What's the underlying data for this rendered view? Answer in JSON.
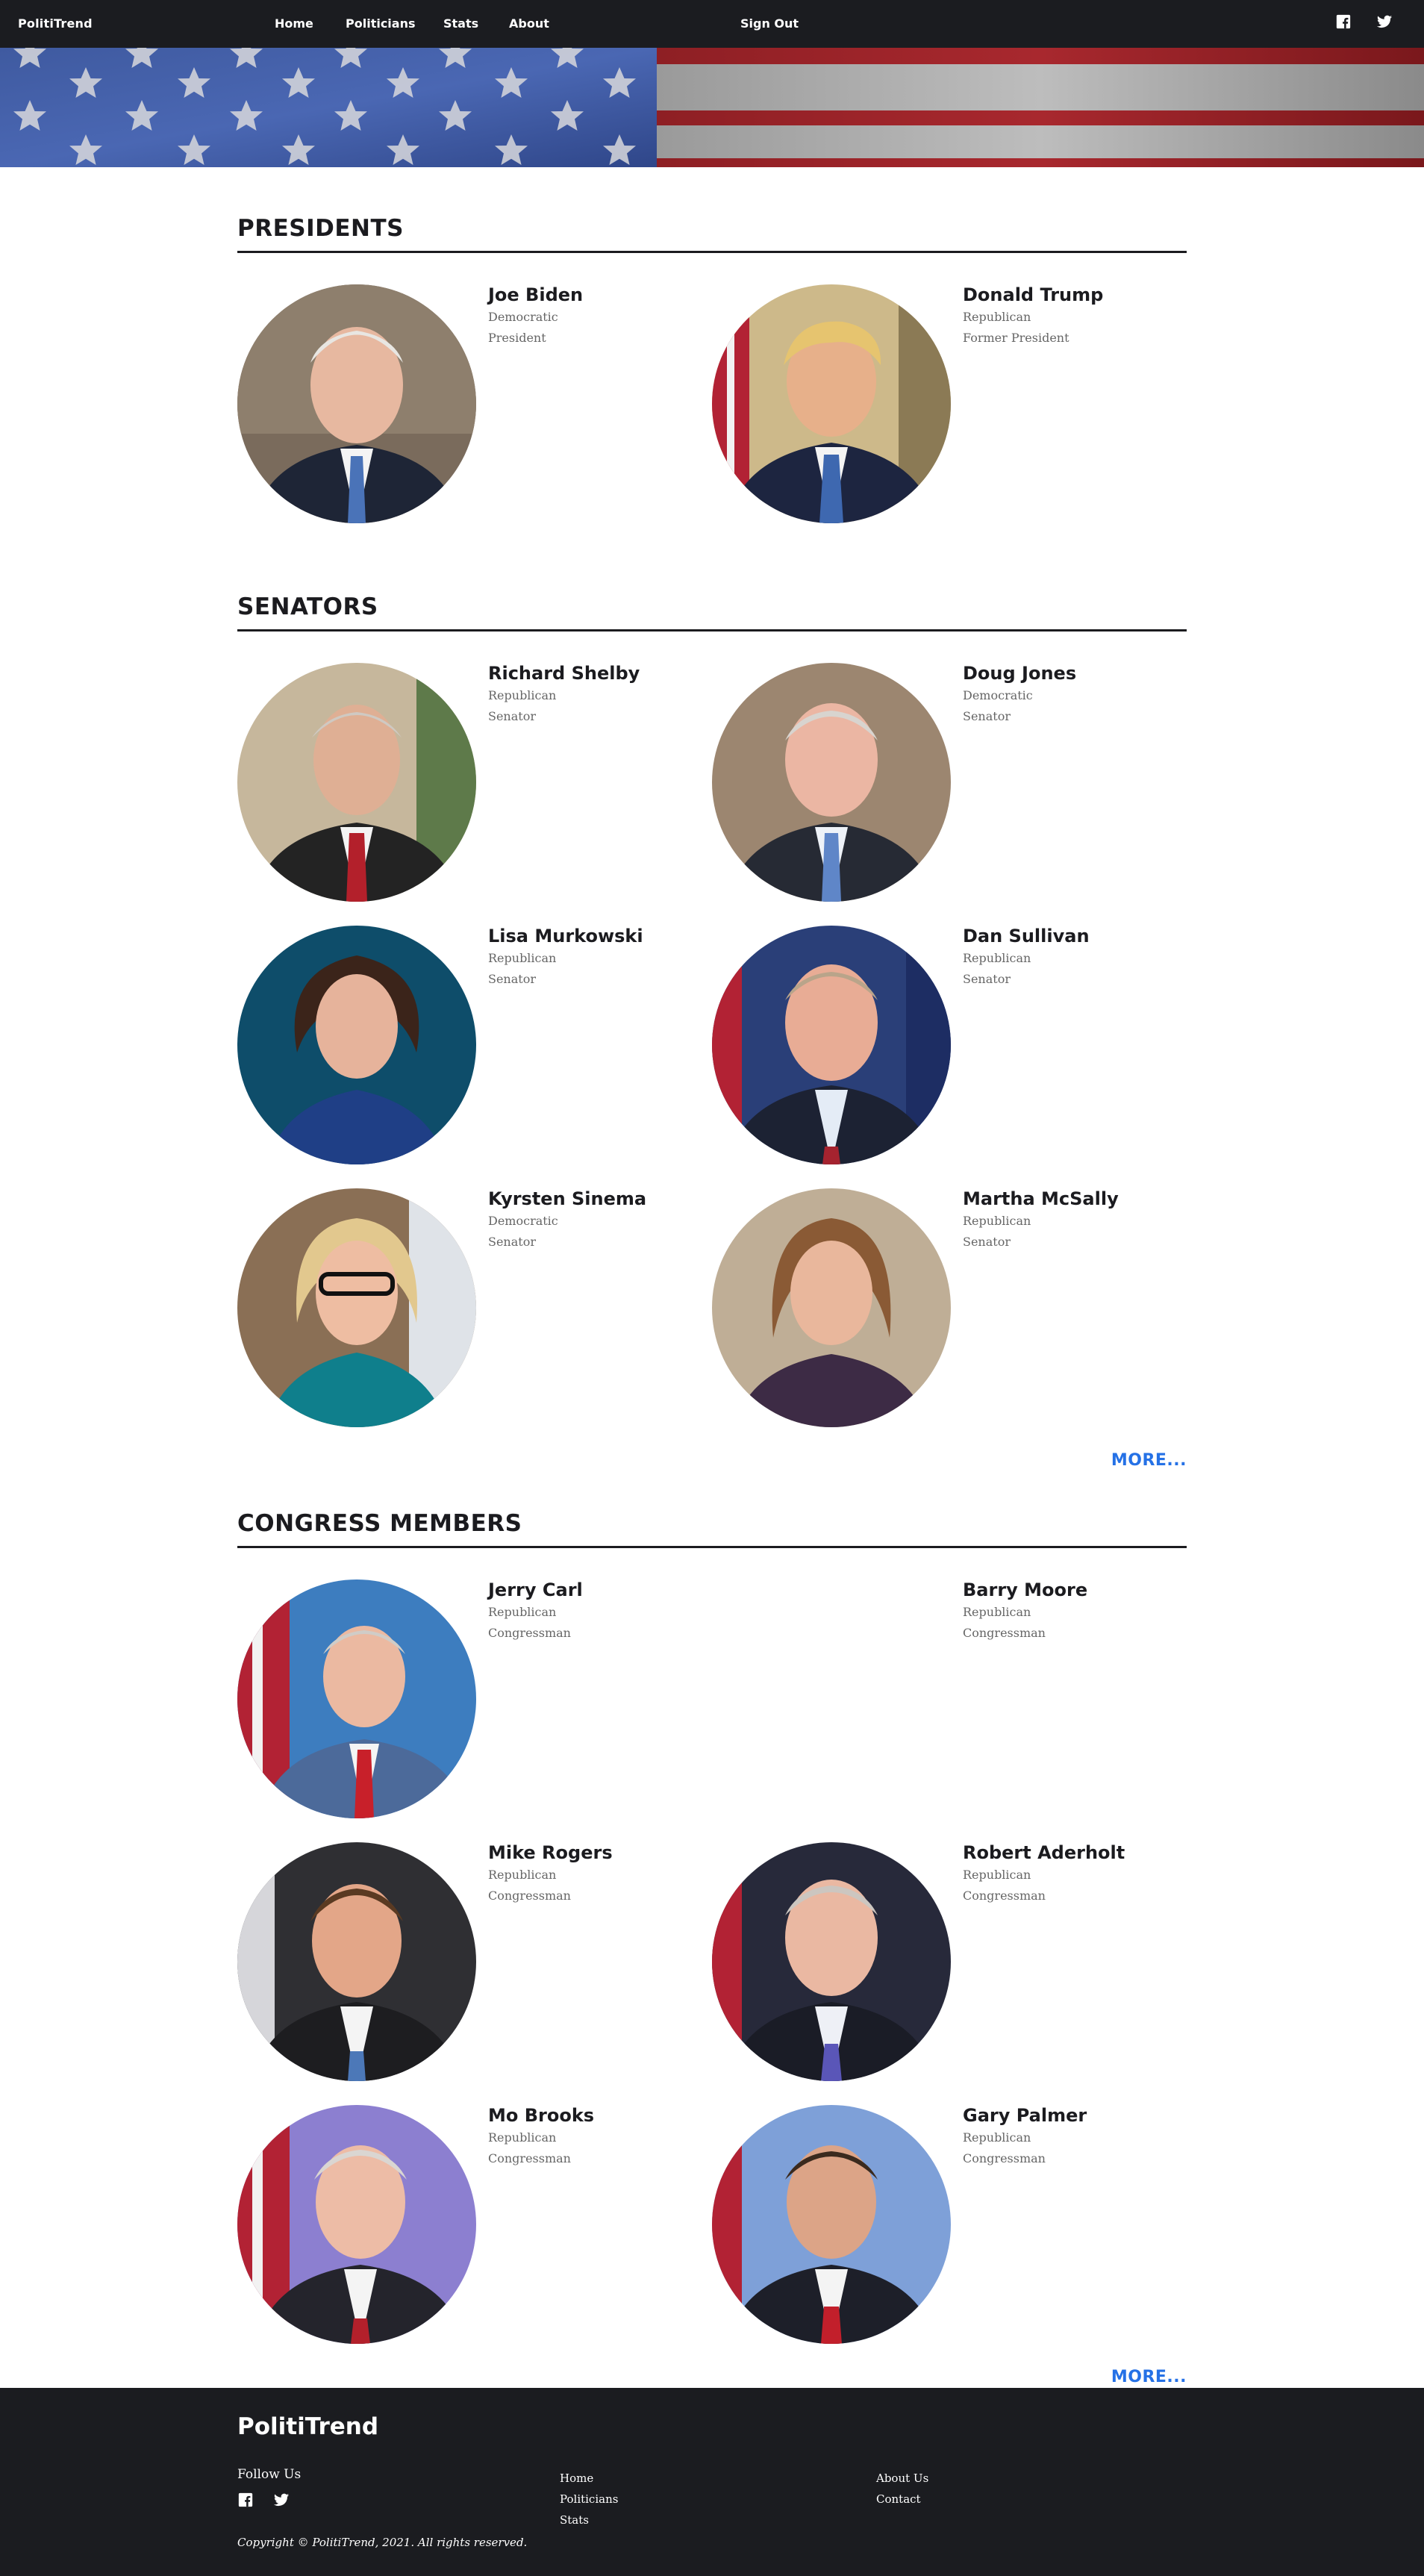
{
  "nav": {
    "brand": "PolitiTrend",
    "links": [
      "Home",
      "Politicians",
      "Stats",
      "About"
    ],
    "signout": "Sign Out",
    "social_icons": [
      "facebook-icon",
      "twitter-icon"
    ]
  },
  "sections": [
    {
      "title": "PRESIDENTS",
      "people": [
        {
          "name": "Joe Biden",
          "party": "Democratic",
          "role": "President"
        },
        {
          "name": "Donald Trump",
          "party": "Republican",
          "role": "Former President"
        }
      ]
    },
    {
      "title": "SENATORS",
      "people": [
        {
          "name": "Richard Shelby",
          "party": "Republican",
          "role": "Senator"
        },
        {
          "name": "Doug Jones",
          "party": "Democratic",
          "role": "Senator"
        },
        {
          "name": "Lisa Murkowski",
          "party": "Republican",
          "role": "Senator"
        },
        {
          "name": "Dan Sullivan",
          "party": "Republican",
          "role": "Senator"
        },
        {
          "name": "Kyrsten Sinema",
          "party": "Democratic",
          "role": "Senator"
        },
        {
          "name": "Martha McSally",
          "party": "Republican",
          "role": "Senator"
        }
      ],
      "more": "MORE..."
    },
    {
      "title": "CONGRESS MEMBERS",
      "people": [
        {
          "name": "Jerry Carl",
          "party": "Republican",
          "role": "Congressman"
        },
        {
          "name": "Barry Moore",
          "party": "Republican",
          "role": "Congressman"
        },
        {
          "name": "Mike Rogers",
          "party": "Republican",
          "role": "Congressman"
        },
        {
          "name": "Robert Aderholt",
          "party": "Republican",
          "role": "Congressman"
        },
        {
          "name": "Mo Brooks",
          "party": "Republican",
          "role": "Congressman"
        },
        {
          "name": "Gary Palmer",
          "party": "Republican",
          "role": "Congressman"
        }
      ],
      "more": "MORE..."
    }
  ],
  "footer": {
    "brand": "PolitiTrend",
    "follow": "Follow Us",
    "col1": [
      "Home",
      "Politicians",
      "Stats"
    ],
    "col2": [
      "About Us",
      "Contact"
    ],
    "copyright": "Copyright © PolitiTrend, 2021. All rights reserved."
  },
  "colors": {
    "nav_bg": "#1b1c20",
    "link_blue": "#2571e6",
    "text_dark": "#1b1b1f",
    "text_muted": "#666666"
  }
}
